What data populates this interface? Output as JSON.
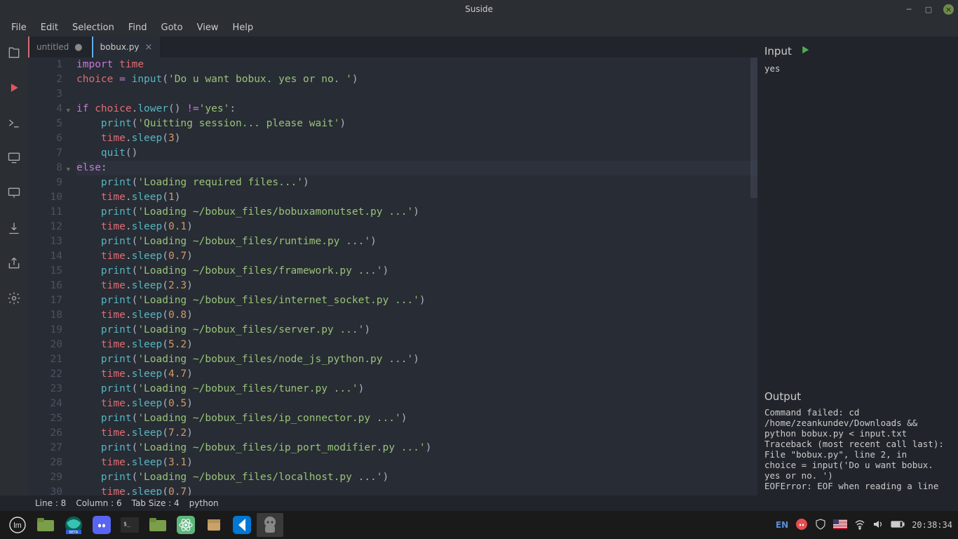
{
  "window": {
    "title": "Suside"
  },
  "menu": {
    "file": "File",
    "edit": "Edit",
    "selection": "Selection",
    "find": "Find",
    "goto": "Goto",
    "view": "View",
    "help": "Help"
  },
  "tabs": [
    {
      "label": "untitled",
      "active": false,
      "modified": true
    },
    {
      "label": "bobux.py",
      "active": true,
      "modified": false
    }
  ],
  "code_lines": [
    {
      "n": 1,
      "seg": [
        [
          "kw",
          "import"
        ],
        [
          "pl",
          " "
        ],
        [
          "id",
          "time"
        ]
      ]
    },
    {
      "n": 2,
      "seg": [
        [
          "id",
          "choice"
        ],
        [
          "pl",
          " "
        ],
        [
          "op",
          "="
        ],
        [
          "pl",
          " "
        ],
        [
          "fn",
          "input"
        ],
        [
          "pl",
          "("
        ],
        [
          "str",
          "'Do u want bobux. yes or no. '"
        ],
        [
          "pl",
          ")"
        ]
      ]
    },
    {
      "n": 3,
      "seg": [
        [
          "pl",
          ""
        ]
      ]
    },
    {
      "n": 4,
      "fold": true,
      "seg": [
        [
          "kw",
          "if"
        ],
        [
          "pl",
          " "
        ],
        [
          "id",
          "choice"
        ],
        [
          "pl",
          "."
        ],
        [
          "fn",
          "lower"
        ],
        [
          "pl",
          "() "
        ],
        [
          "op",
          "!="
        ],
        [
          "str",
          "'yes'"
        ],
        [
          "pl",
          ":"
        ]
      ]
    },
    {
      "n": 5,
      "seg": [
        [
          "pl",
          "    "
        ],
        [
          "fn",
          "print"
        ],
        [
          "pl",
          "("
        ],
        [
          "str",
          "'Quitting session... please wait'"
        ],
        [
          "pl",
          ")"
        ]
      ]
    },
    {
      "n": 6,
      "seg": [
        [
          "pl",
          "    "
        ],
        [
          "id",
          "time"
        ],
        [
          "pl",
          "."
        ],
        [
          "fn",
          "sleep"
        ],
        [
          "pl",
          "("
        ],
        [
          "num",
          "3"
        ],
        [
          "pl",
          ")"
        ]
      ]
    },
    {
      "n": 7,
      "seg": [
        [
          "pl",
          "    "
        ],
        [
          "fn",
          "quit"
        ],
        [
          "pl",
          "()"
        ]
      ]
    },
    {
      "n": 8,
      "fold": true,
      "hl": true,
      "seg": [
        [
          "kw",
          "else"
        ],
        [
          "pl",
          ":"
        ]
      ]
    },
    {
      "n": 9,
      "seg": [
        [
          "pl",
          "    "
        ],
        [
          "fn",
          "print"
        ],
        [
          "pl",
          "("
        ],
        [
          "str",
          "'Loading required files...'"
        ],
        [
          "pl",
          ")"
        ]
      ]
    },
    {
      "n": 10,
      "seg": [
        [
          "pl",
          "    "
        ],
        [
          "id",
          "time"
        ],
        [
          "pl",
          "."
        ],
        [
          "fn",
          "sleep"
        ],
        [
          "pl",
          "("
        ],
        [
          "num",
          "1"
        ],
        [
          "pl",
          ")"
        ]
      ]
    },
    {
      "n": 11,
      "seg": [
        [
          "pl",
          "    "
        ],
        [
          "fn",
          "print"
        ],
        [
          "pl",
          "("
        ],
        [
          "str",
          "'Loading ~/bobux_files/bobuxamonutset.py ...'"
        ],
        [
          "pl",
          ")"
        ]
      ]
    },
    {
      "n": 12,
      "seg": [
        [
          "pl",
          "    "
        ],
        [
          "id",
          "time"
        ],
        [
          "pl",
          "."
        ],
        [
          "fn",
          "sleep"
        ],
        [
          "pl",
          "("
        ],
        [
          "num",
          "0.1"
        ],
        [
          "pl",
          ")"
        ]
      ]
    },
    {
      "n": 13,
      "seg": [
        [
          "pl",
          "    "
        ],
        [
          "fn",
          "print"
        ],
        [
          "pl",
          "("
        ],
        [
          "str",
          "'Loading ~/bobux_files/runtime.py ...'"
        ],
        [
          "pl",
          ")"
        ]
      ]
    },
    {
      "n": 14,
      "seg": [
        [
          "pl",
          "    "
        ],
        [
          "id",
          "time"
        ],
        [
          "pl",
          "."
        ],
        [
          "fn",
          "sleep"
        ],
        [
          "pl",
          "("
        ],
        [
          "num",
          "0.7"
        ],
        [
          "pl",
          ")"
        ]
      ]
    },
    {
      "n": 15,
      "seg": [
        [
          "pl",
          "    "
        ],
        [
          "fn",
          "print"
        ],
        [
          "pl",
          "("
        ],
        [
          "str",
          "'Loading ~/bobux_files/framework.py ...'"
        ],
        [
          "pl",
          ")"
        ]
      ]
    },
    {
      "n": 16,
      "seg": [
        [
          "pl",
          "    "
        ],
        [
          "id",
          "time"
        ],
        [
          "pl",
          "."
        ],
        [
          "fn",
          "sleep"
        ],
        [
          "pl",
          "("
        ],
        [
          "num",
          "2.3"
        ],
        [
          "pl",
          ")"
        ]
      ]
    },
    {
      "n": 17,
      "seg": [
        [
          "pl",
          "    "
        ],
        [
          "fn",
          "print"
        ],
        [
          "pl",
          "("
        ],
        [
          "str",
          "'Loading ~/bobux_files/internet_socket.py ...'"
        ],
        [
          "pl",
          ")"
        ]
      ]
    },
    {
      "n": 18,
      "seg": [
        [
          "pl",
          "    "
        ],
        [
          "id",
          "time"
        ],
        [
          "pl",
          "."
        ],
        [
          "fn",
          "sleep"
        ],
        [
          "pl",
          "("
        ],
        [
          "num",
          "0.8"
        ],
        [
          "pl",
          ")"
        ]
      ]
    },
    {
      "n": 19,
      "seg": [
        [
          "pl",
          "    "
        ],
        [
          "fn",
          "print"
        ],
        [
          "pl",
          "("
        ],
        [
          "str",
          "'Loading ~/bobux_files/server.py ...'"
        ],
        [
          "pl",
          ")"
        ]
      ]
    },
    {
      "n": 20,
      "seg": [
        [
          "pl",
          "    "
        ],
        [
          "id",
          "time"
        ],
        [
          "pl",
          "."
        ],
        [
          "fn",
          "sleep"
        ],
        [
          "pl",
          "("
        ],
        [
          "num",
          "5.2"
        ],
        [
          "pl",
          ")"
        ]
      ]
    },
    {
      "n": 21,
      "seg": [
        [
          "pl",
          "    "
        ],
        [
          "fn",
          "print"
        ],
        [
          "pl",
          "("
        ],
        [
          "str",
          "'Loading ~/bobux_files/node_js_python.py ...'"
        ],
        [
          "pl",
          ")"
        ]
      ]
    },
    {
      "n": 22,
      "seg": [
        [
          "pl",
          "    "
        ],
        [
          "id",
          "time"
        ],
        [
          "pl",
          "."
        ],
        [
          "fn",
          "sleep"
        ],
        [
          "pl",
          "("
        ],
        [
          "num",
          "4.7"
        ],
        [
          "pl",
          ")"
        ]
      ]
    },
    {
      "n": 23,
      "seg": [
        [
          "pl",
          "    "
        ],
        [
          "fn",
          "print"
        ],
        [
          "pl",
          "("
        ],
        [
          "str",
          "'Loading ~/bobux_files/tuner.py ...'"
        ],
        [
          "pl",
          ")"
        ]
      ]
    },
    {
      "n": 24,
      "seg": [
        [
          "pl",
          "    "
        ],
        [
          "id",
          "time"
        ],
        [
          "pl",
          "."
        ],
        [
          "fn",
          "sleep"
        ],
        [
          "pl",
          "("
        ],
        [
          "num",
          "0.5"
        ],
        [
          "pl",
          ")"
        ]
      ]
    },
    {
      "n": 25,
      "seg": [
        [
          "pl",
          "    "
        ],
        [
          "fn",
          "print"
        ],
        [
          "pl",
          "("
        ],
        [
          "str",
          "'Loading ~/bobux_files/ip_connector.py ...'"
        ],
        [
          "pl",
          ")"
        ]
      ]
    },
    {
      "n": 26,
      "seg": [
        [
          "pl",
          "    "
        ],
        [
          "id",
          "time"
        ],
        [
          "pl",
          "."
        ],
        [
          "fn",
          "sleep"
        ],
        [
          "pl",
          "("
        ],
        [
          "num",
          "7.2"
        ],
        [
          "pl",
          ")"
        ]
      ]
    },
    {
      "n": 27,
      "seg": [
        [
          "pl",
          "    "
        ],
        [
          "fn",
          "print"
        ],
        [
          "pl",
          "("
        ],
        [
          "str",
          "'Loading ~/bobux_files/ip_port_modifier.py ...'"
        ],
        [
          "pl",
          ")"
        ]
      ]
    },
    {
      "n": 28,
      "seg": [
        [
          "pl",
          "    "
        ],
        [
          "id",
          "time"
        ],
        [
          "pl",
          "."
        ],
        [
          "fn",
          "sleep"
        ],
        [
          "pl",
          "("
        ],
        [
          "num",
          "3.1"
        ],
        [
          "pl",
          ")"
        ]
      ]
    },
    {
      "n": 29,
      "seg": [
        [
          "pl",
          "    "
        ],
        [
          "fn",
          "print"
        ],
        [
          "pl",
          "("
        ],
        [
          "str",
          "'Loading ~/bobux_files/localhost.py ...'"
        ],
        [
          "pl",
          ")"
        ]
      ]
    },
    {
      "n": 30,
      "seg": [
        [
          "pl",
          "    "
        ],
        [
          "id",
          "time"
        ],
        [
          "pl",
          "."
        ],
        [
          "fn",
          "sleep"
        ],
        [
          "pl",
          "("
        ],
        [
          "num",
          "0.7"
        ],
        [
          "pl",
          ")"
        ]
      ]
    }
  ],
  "input_panel": {
    "title": "Input",
    "content": "yes"
  },
  "output_panel": {
    "title": "Output",
    "content": "Command failed: cd /home/zeankundev/Downloads && python bobux.py < input.txt\nTraceback (most recent call last):\nFile \"bobux.py\", line 2, in\nchoice = input('Do u want bobux. yes or no. ')\nEOFError: EOF when reading a line"
  },
  "status": {
    "line": "Line : 8",
    "column": "Column : 6",
    "tabsize": "Tab Size : 4",
    "lang": "python"
  },
  "tray": {
    "lang": "EN",
    "time": "20:38:34"
  }
}
